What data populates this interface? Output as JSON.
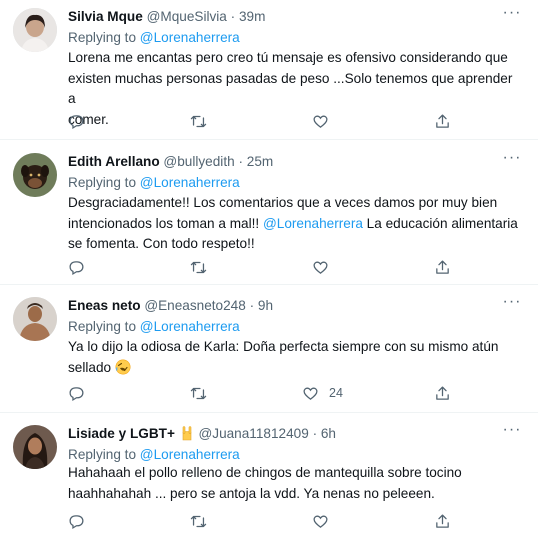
{
  "replying_to_label": "Replying to",
  "tweets": [
    {
      "name": "Silvia Mque",
      "handle": "@MqueSilvia",
      "separator": "·",
      "time": "39m",
      "replying_to": "@Lorenaherrera",
      "lines": [
        "Lorena me encantas pero creo tú mensaje es ofensivo considerando que",
        "existen muchas personas pasadas de peso ...Solo tenemos que aprender a",
        "comer."
      ],
      "like_count": ""
    },
    {
      "name": "Edith Arellano",
      "handle": "@bullyedith",
      "separator": "·",
      "time": "25m",
      "replying_to": "@Lorenaherrera",
      "line1": "Desgraciadamente!! Los comentarios que a veces damos por muy bien",
      "line2_before": "intencionados los toman a mal!! ",
      "line2_mention": "@Lorenaherrera",
      "line2_after": " La educación alimentaria",
      "line3": "se fomenta. Con todo respeto!!",
      "like_count": ""
    },
    {
      "name": "Eneas neto",
      "handle": "@Eneasneto248",
      "separator": "·",
      "time": "9h",
      "replying_to": "@Lorenaherrera",
      "line1": "Ya lo dijo la odiosa de Karla: Doña perfecta siempre con su mismo atún",
      "line2": "sellado",
      "emoji": "rolling-on-floor-laughing-emoji",
      "like_count": "24"
    },
    {
      "name": "Lisiade y LGBT+",
      "badge": "sign-of-the-horns-emoji",
      "handle": "@Juana11812409",
      "separator": "·",
      "time": "6h",
      "replying_to": "@Lorenaherrera",
      "lines": [
        "Hahahaah el pollo relleno de chingos de mantequilla sobre tocino",
        "haahhahahah ... pero se antoja la vdd. Ya nenas no peleeen."
      ],
      "like_count": ""
    }
  ],
  "more_label": "···",
  "icons": {
    "reply": "reply-icon",
    "retweet": "retweet-icon",
    "like": "heart-icon",
    "share": "share-icon",
    "more": "more-icon"
  },
  "colors": {
    "accent": "#1d9bf0",
    "text": "#0f1419",
    "secondary": "#536471",
    "divider": "#eff3f4"
  }
}
